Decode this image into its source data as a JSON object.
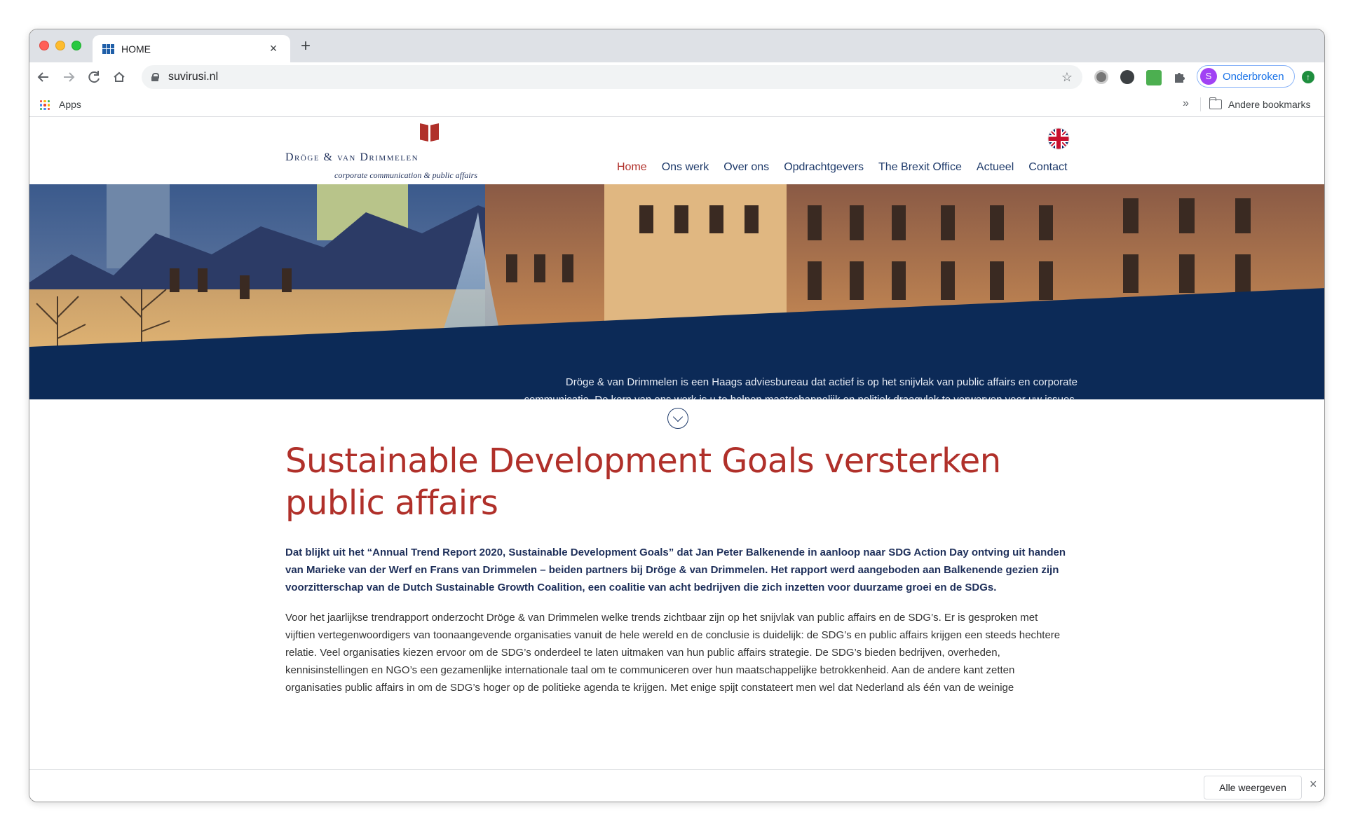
{
  "browser": {
    "tab_title": "HOME",
    "tab_close": "×",
    "new_tab": "+",
    "url": "suvirusi.nl",
    "profile_initial": "S",
    "profile_label": "Onderbroken",
    "update_glyph": "↑"
  },
  "bookmarks": {
    "apps_label": "Apps",
    "overflow": "»",
    "other_label": "Andere bookmarks"
  },
  "site": {
    "logo_name": "Dröge & van Drimmelen",
    "logo_tagline": "corporate communication & public affairs",
    "nav": [
      {
        "label": "Home",
        "active": true
      },
      {
        "label": "Ons werk"
      },
      {
        "label": "Over ons"
      },
      {
        "label": "Opdrachtgevers"
      },
      {
        "label": "The Brexit Office"
      },
      {
        "label": "Actueel"
      },
      {
        "label": "Contact"
      }
    ],
    "hero_text": "Dröge & van Drimmelen is een Haags adviesbureau dat actief is op het snijvlak van public affairs en corporate communicatie. De kern van ons werk is u te helpen maatschappelijk en politiek draagvlak te verwerven voor uw issues. Wij hebben een breed netwerk binnen politiek en ambtelijk Den Haag, Brussel en onder maatschappelijke organisaties."
  },
  "article": {
    "title": "Sustainable Development Goals versterken public affairs",
    "lead": "Dat blijkt uit het “Annual Trend Report 2020, Sustainable Development Goals” dat Jan Peter Balkenende in aanloop naar SDG Action Day ontving uit handen van Marieke van der Werf en Frans van Drimmelen – beiden partners bij Dröge & van Drimmelen. Het rapport werd aangeboden aan Balkenende gezien zijn voorzitterschap van de Dutch Sustainable Growth Coalition, een coalitie van acht bedrijven die zich inzetten voor duurzame groei en de SDGs.",
    "body": "Voor het jaarlijkse trendrapport onderzocht Dröge & van Drimmelen welke trends zichtbaar zijn op het snijvlak van public affairs en de SDG’s. Er is gesproken met vijftien vertegenwoordigers van toonaangevende organisaties vanuit de hele wereld en de conclusie is duidelijk: de SDG’s en public affairs krijgen een steeds hechtere relatie. Veel organisaties kiezen ervoor om de SDG’s onderdeel te laten uitmaken van hun public affairs strategie. De SDG’s bieden bedrijven, overheden, kennisinstellingen en NGO’s een gezamenlijke internationale taal om te communiceren over hun maatschappelijke betrokkenheid. Aan de andere kant zetten organisaties public affairs in om de SDG’s hoger op de politieke agenda te krijgen. Met enige spijt constateert men wel dat Nederland als één van de weinige"
  },
  "download_bar": {
    "show_all": "Alle weergeven",
    "close": "×"
  },
  "colors": {
    "brand_red": "#b0302a",
    "brand_navy": "#0c2a57",
    "nav_blue": "#1e3a6a"
  }
}
